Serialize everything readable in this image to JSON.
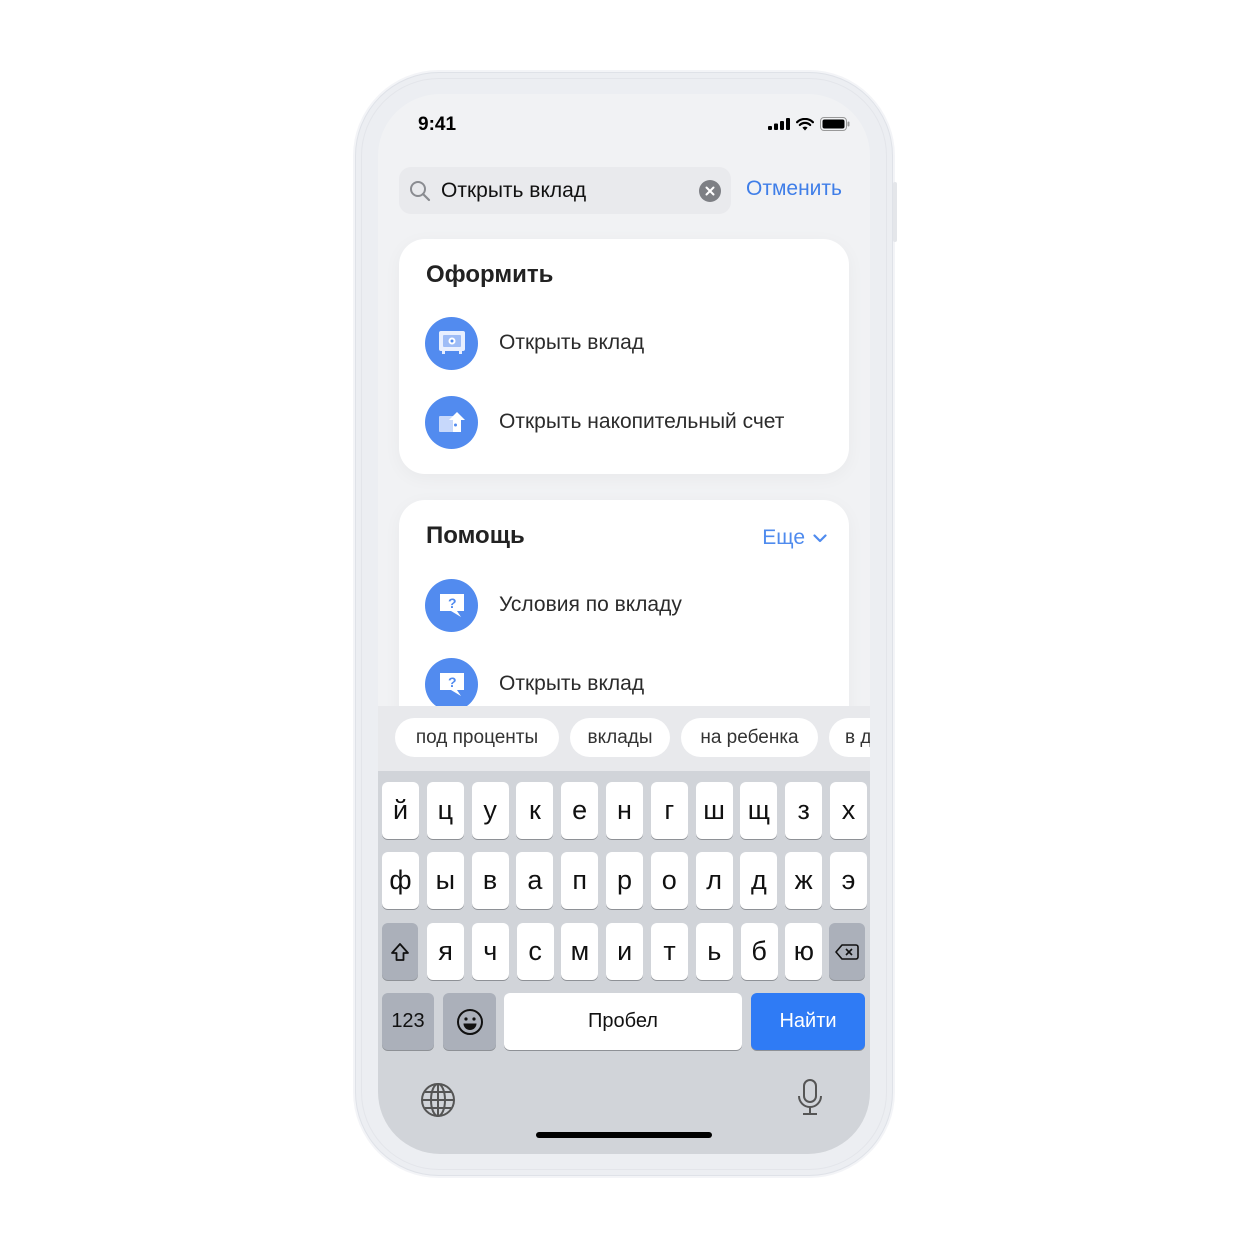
{
  "status_bar": {
    "time": "9:41",
    "icons": [
      "signal-icon",
      "wifi-icon",
      "battery-icon"
    ]
  },
  "search": {
    "value": "Открыть вклад",
    "cancel_label": "Отменить"
  },
  "sections": [
    {
      "title": "Оформить",
      "items": [
        {
          "label": "Открыть вклад",
          "icon": "safe-icon"
        },
        {
          "label": "Открыть накопительный счет",
          "icon": "savings-account-icon"
        }
      ]
    },
    {
      "title": "Помощь",
      "more_label": "Еще",
      "items": [
        {
          "label": "Условия по вкладу",
          "icon": "help-chat-icon"
        },
        {
          "label": "Открыть вклад",
          "icon": "help-chat-icon"
        }
      ]
    }
  ],
  "suggestions": [
    "под проценты",
    "вклады",
    "на ребенка",
    "в д"
  ],
  "keyboard": {
    "row1": [
      "й",
      "ц",
      "у",
      "к",
      "е",
      "н",
      "г",
      "ш",
      "щ",
      "з",
      "х"
    ],
    "row2": [
      "ф",
      "ы",
      "в",
      "а",
      "п",
      "р",
      "о",
      "л",
      "д",
      "ж",
      "э"
    ],
    "row3": [
      "я",
      "ч",
      "с",
      "м",
      "и",
      "т",
      "ь",
      "б",
      "ю"
    ],
    "numbers_label": "123",
    "space_label": "Пробел",
    "go_label": "Найти"
  },
  "colors": {
    "accent": "#3f7ee8",
    "icon_bg": "#528bef",
    "go_key": "#2f7bf5"
  }
}
